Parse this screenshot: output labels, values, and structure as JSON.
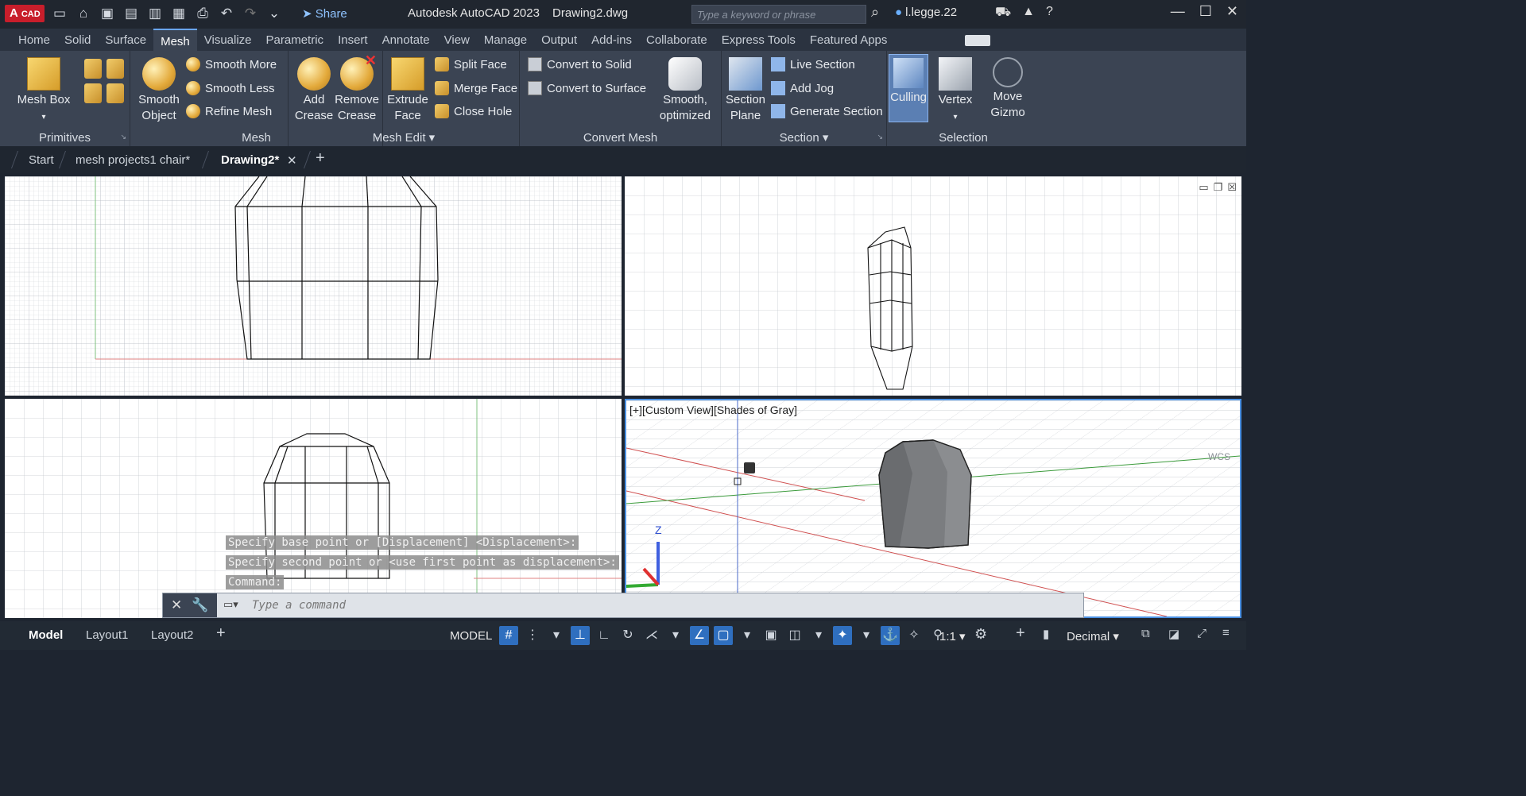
{
  "app": {
    "logo_big": "A",
    "logo_small": "CAD",
    "title": "Autodesk AutoCAD 2023",
    "file": "Drawing2.dwg",
    "share_label": "Share",
    "search_placeholder": "Type a keyword or phrase",
    "user": "l.legge.22"
  },
  "ribbon_tabs": [
    "Home",
    "Solid",
    "Surface",
    "Mesh",
    "Visualize",
    "Parametric",
    "Insert",
    "Annotate",
    "View",
    "Manage",
    "Output",
    "Add-ins",
    "Collaborate",
    "Express Tools",
    "Featured Apps"
  ],
  "active_ribbon_tab": "Mesh",
  "panels": {
    "primitives": {
      "title": "Primitives",
      "mesh_box": "Mesh Box"
    },
    "mesh": {
      "title": "Mesh",
      "smooth_object_1": "Smooth",
      "smooth_object_2": "Object",
      "smooth_more": "Smooth More",
      "smooth_less": "Smooth Less",
      "refine_mesh": "Refine Mesh"
    },
    "mesh_edit": {
      "title": "Mesh Edit",
      "add_crease_1": "Add",
      "add_crease_2": "Crease",
      "remove_crease_1": "Remove",
      "remove_crease_2": "Crease",
      "extrude_face_1": "Extrude",
      "extrude_face_2": "Face",
      "split_face": "Split Face",
      "merge_face": "Merge Face",
      "close_hole": "Close Hole"
    },
    "convert_mesh": {
      "title": "Convert Mesh",
      "convert_to_solid": "Convert to Solid",
      "convert_to_surface": "Convert to Surface",
      "smooth_optimized_1": "Smooth,",
      "smooth_optimized_2": "optimized"
    },
    "section": {
      "title": "Section",
      "section_plane_1": "Section",
      "section_plane_2": "Plane",
      "live_section": "Live Section",
      "add_jog": "Add Jog",
      "generate_section": "Generate Section"
    },
    "selection": {
      "title": "Selection",
      "culling": "Culling",
      "vertex": "Vertex",
      "move_gizmo_1": "Move",
      "move_gizmo_2": "Gizmo"
    }
  },
  "doc_tabs": {
    "start": "Start",
    "chair": "mesh projects1 chair*",
    "drawing2": "Drawing2*"
  },
  "viewports": {
    "custom_label": "[+][Custom View][Shades of Gray]",
    "wcs": "WCS"
  },
  "command": {
    "history": [
      "Specify base point or [Displacement] <Displacement>:",
      "Specify second point or <use first point as displacement>:",
      "Command:"
    ],
    "placeholder": "Type a command"
  },
  "status": {
    "layouts": [
      "Model",
      "Layout1",
      "Layout2"
    ],
    "model_label": "MODEL",
    "scale": "1:1",
    "units": "Decimal"
  },
  "colors": {
    "accent": "#2f6fbf",
    "logo": "#c81e2b",
    "ribbon": "#3b4453"
  }
}
